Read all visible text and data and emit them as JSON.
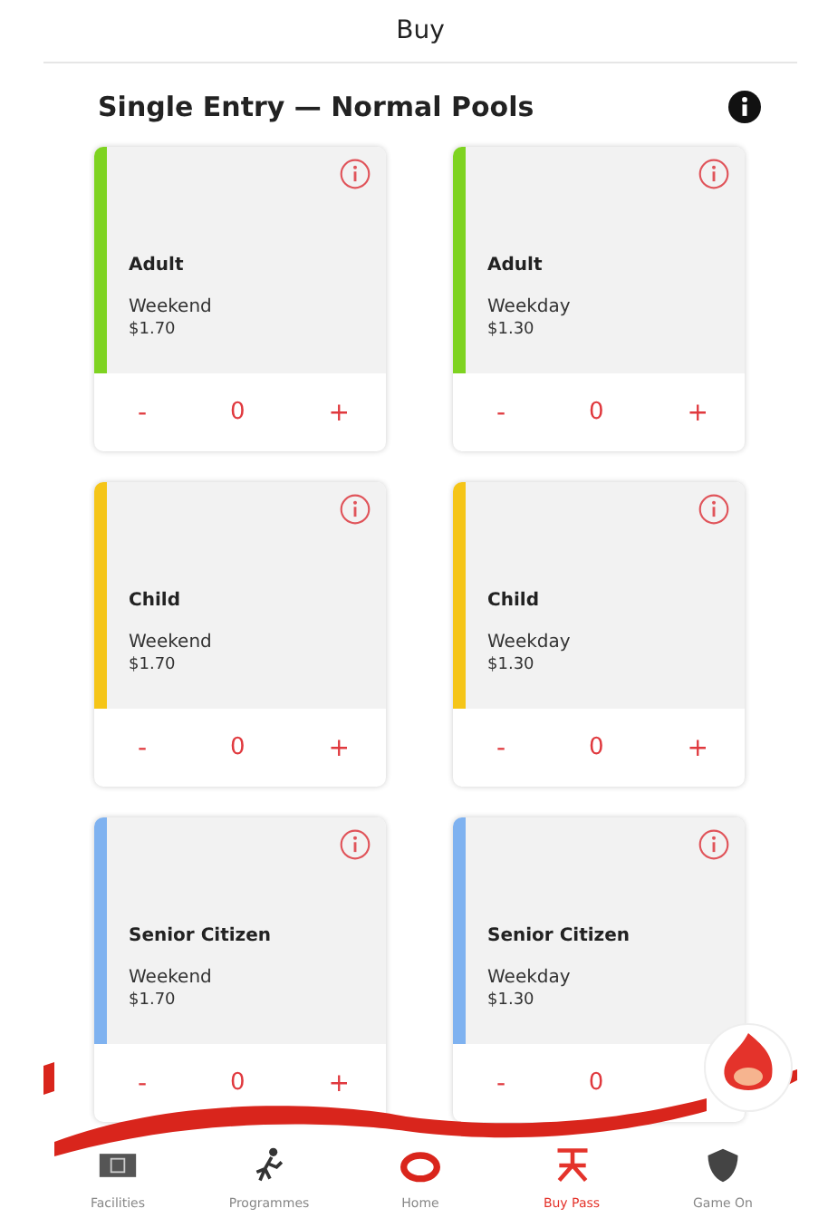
{
  "header": {
    "title": "Buy"
  },
  "section": {
    "title": "Single Entry — Normal Pools"
  },
  "cards": [
    {
      "label": "Adult",
      "day": "Weekend",
      "price": "$1.70",
      "color": "#7ed321",
      "minus": "-",
      "count": "0",
      "plus": "+"
    },
    {
      "label": "Adult",
      "day": "Weekday",
      "price": "$1.30",
      "color": "#7ed321",
      "minus": "-",
      "count": "0",
      "plus": "+"
    },
    {
      "label": "Child",
      "day": "Weekend",
      "price": "$1.70",
      "color": "#f5c518",
      "minus": "-",
      "count": "0",
      "plus": "+"
    },
    {
      "label": "Child",
      "day": "Weekday",
      "price": "$1.30",
      "color": "#f5c518",
      "minus": "-",
      "count": "0",
      "plus": "+"
    },
    {
      "label": "Senior Citizen",
      "day": "Weekend",
      "price": "$1.70",
      "color": "#7fb2f0",
      "minus": "-",
      "count": "0",
      "plus": "+"
    },
    {
      "label": "Senior Citizen",
      "day": "Weekday",
      "price": "$1.30",
      "color": "#7fb2f0",
      "minus": "-",
      "count": "0"
    }
  ],
  "nav": [
    {
      "kind": "facilities",
      "label": "Facilities",
      "selected": false
    },
    {
      "kind": "programmes",
      "label": "Programmes",
      "selected": false
    },
    {
      "kind": "home",
      "label": "Home",
      "selected": false
    },
    {
      "kind": "pass",
      "label": "Buy Pass",
      "selected": true
    },
    {
      "kind": "game",
      "label": "Game On",
      "selected": false
    }
  ]
}
